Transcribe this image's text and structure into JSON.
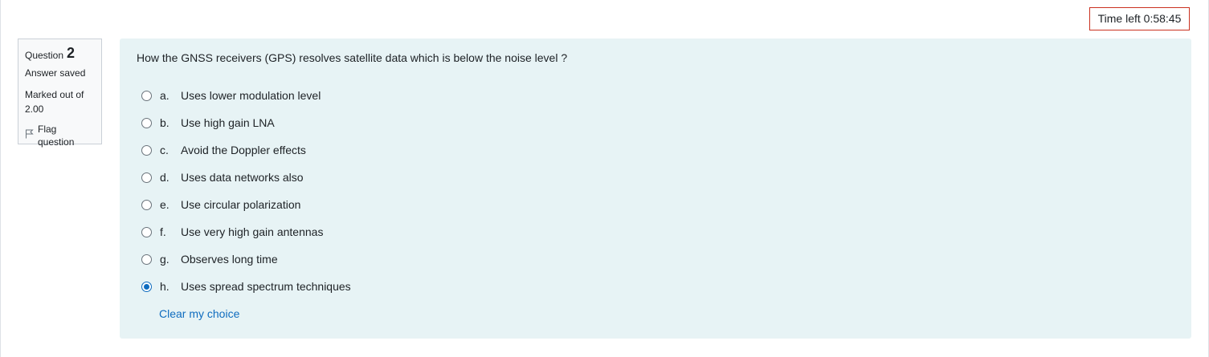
{
  "timer": {
    "label": "Time left 0:58:45"
  },
  "question_info": {
    "label": "Question",
    "number": "2",
    "state": "Answer saved",
    "grade_line1": "Marked out of",
    "grade_line2": "2.00",
    "flag_label": "Flag question"
  },
  "question": {
    "text": "How the GNSS receivers (GPS) resolves satellite data which is below the noise level ?",
    "options": [
      {
        "letter": "a.",
        "text": "Uses lower modulation level",
        "selected": false
      },
      {
        "letter": "b.",
        "text": "Use high gain LNA",
        "selected": false
      },
      {
        "letter": "c.",
        "text": "Avoid the Doppler effects",
        "selected": false
      },
      {
        "letter": "d.",
        "text": "Uses data networks also",
        "selected": false
      },
      {
        "letter": "e.",
        "text": "Use circular polarization",
        "selected": false
      },
      {
        "letter": "f.",
        "text": "Use very high gain antennas",
        "selected": false
      },
      {
        "letter": "g.",
        "text": "Observes long time",
        "selected": false
      },
      {
        "letter": "h.",
        "text": "Uses spread spectrum techniques",
        "selected": true
      }
    ],
    "clear_label": "Clear my choice"
  },
  "colors": {
    "accent": "#0f6cbf",
    "timer_border": "#ca3120",
    "content_bg": "#e7f3f5",
    "info_bg": "#f8f9fa"
  },
  "icons": {
    "flag": "flag-icon"
  }
}
